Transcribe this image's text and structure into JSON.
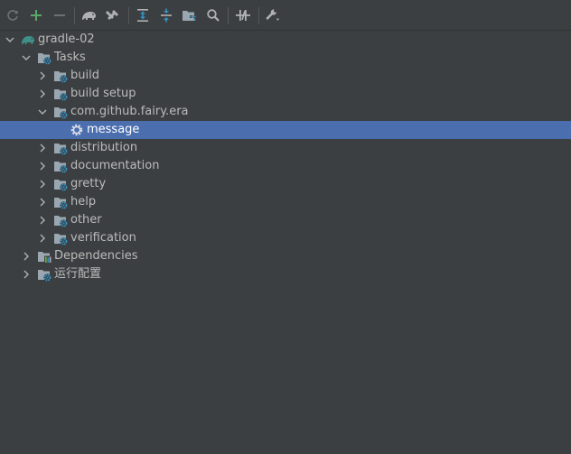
{
  "toolbar": {
    "buttons": [
      {
        "name": "refresh-icon"
      },
      {
        "name": "add-icon"
      },
      {
        "name": "remove-icon"
      },
      {
        "name": "gradle-elephant-icon"
      },
      {
        "name": "build-tools-icon"
      },
      {
        "name": "expand-all-icon"
      },
      {
        "name": "collapse-all-icon"
      },
      {
        "name": "group-modules-icon"
      },
      {
        "name": "search-icon"
      },
      {
        "name": "toggle-offline-icon"
      },
      {
        "name": "settings-wrench-icon"
      }
    ]
  },
  "colors": {
    "background": "#3c3f41",
    "selection": "#4b6eaf",
    "text": "#bbbbbb",
    "add_green": "#59a869",
    "gradle_teal": "#3f8f8a",
    "gear_blue": "#3592c4",
    "folder_gray": "#9aa7b0"
  },
  "tree": {
    "root": {
      "label": "gradle-02"
    },
    "tasks": {
      "label": "Tasks"
    },
    "build": {
      "label": "build"
    },
    "build_setup": {
      "label": "build setup"
    },
    "fairy_era": {
      "label": "com.github.fairy.era"
    },
    "message": {
      "label": "message"
    },
    "distribution": {
      "label": "distribution"
    },
    "documentation": {
      "label": "documentation"
    },
    "gretty": {
      "label": "gretty"
    },
    "help": {
      "label": "help"
    },
    "other": {
      "label": "other"
    },
    "verification": {
      "label": "verification"
    },
    "dependencies": {
      "label": "Dependencies"
    },
    "run_config": {
      "label": "运行配置"
    }
  }
}
